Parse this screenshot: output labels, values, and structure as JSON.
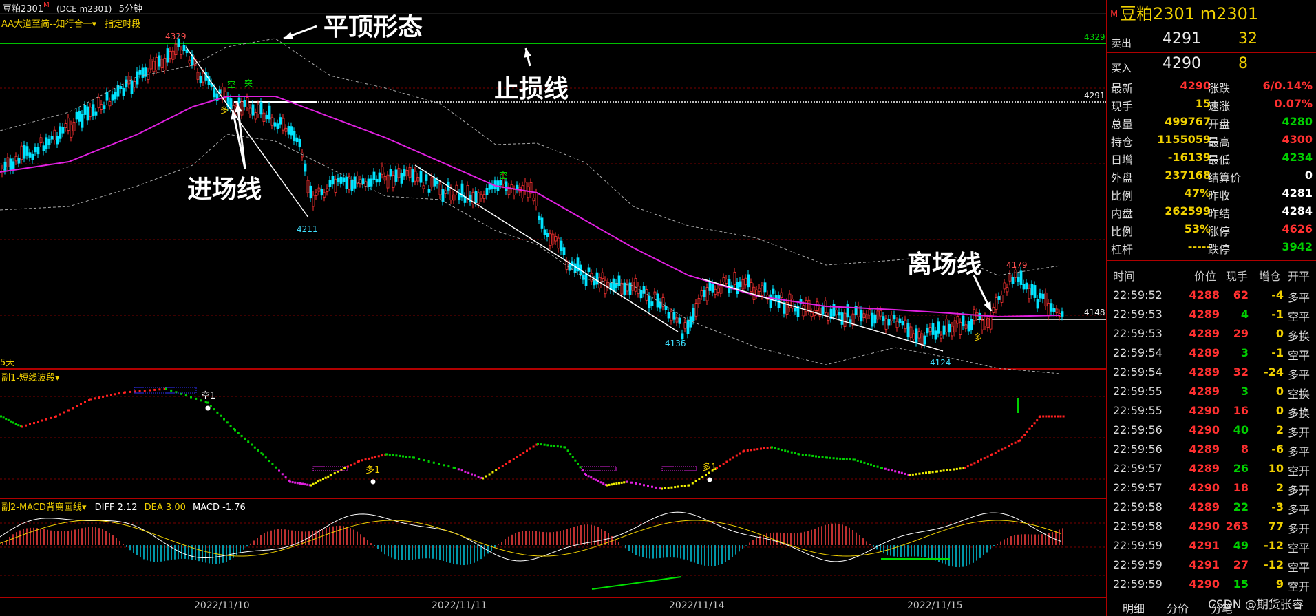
{
  "window": {
    "symbol": "豆粕2301",
    "mark": "M",
    "contract": "(DCE m2301)",
    "period": "5分钟"
  },
  "main_indicator": {
    "name": "AA大道至简--知行合一",
    "dropdown": "▾",
    "extra": "指定时段"
  },
  "annotations": {
    "flat_top": "平顶形态",
    "stop_loss": "止损线",
    "entry": "进场线",
    "exit": "离场线"
  },
  "price_marks": {
    "high": "4329",
    "low1": "4211",
    "low2": "4136",
    "low3": "4124",
    "peak2": "4179",
    "right_4329": "4329",
    "right_4291": "4291",
    "right_4148": "4148",
    "left_days": "5天"
  },
  "signals": {
    "kong": "空",
    "tu": "突",
    "duo": "多",
    "kong1": "空1",
    "duo1": "多1"
  },
  "sub1": {
    "name": "副1-短线波段",
    "dropdown": "▾"
  },
  "sub2": {
    "name": "副2-MACD背离画线",
    "dropdown": "▾",
    "diff_label": "DIFF",
    "diff": "2.12",
    "dea_label": "DEA",
    "dea": "3.00",
    "macd_label": "MACD",
    "macd": "-1.76"
  },
  "dates": [
    "2022/11/10",
    "2022/11/11",
    "2022/11/14",
    "2022/11/15"
  ],
  "colors": {
    "up": "#ff3232",
    "down": "#00e4ff",
    "ma": "#e020e0",
    "green": "#00d000",
    "yellow": "#f0d000",
    "border": "#b00000"
  },
  "right_panel": {
    "mark": "M",
    "title": "豆粕2301  m2301",
    "ask": {
      "label": "卖出",
      "price": "4291",
      "vol": "32"
    },
    "bid": {
      "label": "买入",
      "price": "4290",
      "vol": "8"
    },
    "quotes": [
      {
        "k": "最新",
        "v": "4290",
        "vc": "#ff3030",
        "k2": "涨跌",
        "v2": "6/0.14%",
        "v2c": "#ff3030"
      },
      {
        "k": "现手",
        "v": "15",
        "vc": "#f0d000",
        "k2": "速涨",
        "v2": "0.07%",
        "v2c": "#ff3030"
      },
      {
        "k": "总量",
        "v": "499767",
        "vc": "#f0d000",
        "k2": "开盘",
        "v2": "4280",
        "v2c": "#00d000"
      },
      {
        "k": "持仓",
        "v": "1155059",
        "vc": "#f0d000",
        "k2": "最高",
        "v2": "4300",
        "v2c": "#ff3030"
      },
      {
        "k": "日增",
        "v": "-16139",
        "vc": "#f0d000",
        "k2": "最低",
        "v2": "4234",
        "v2c": "#00d000"
      },
      {
        "k": "外盘",
        "v": "237168",
        "vc": "#f0d000",
        "k2": "结算价",
        "v2": "0",
        "v2c": "#ffffff"
      },
      {
        "k": "比例",
        "v": "47%",
        "vc": "#f0d000",
        "k2": "昨收",
        "v2": "4281",
        "v2c": "#ffffff"
      },
      {
        "k": "内盘",
        "v": "262599",
        "vc": "#f0d000",
        "k2": "昨结",
        "v2": "4284",
        "v2c": "#ffffff"
      },
      {
        "k": "比例",
        "v": "53%",
        "vc": "#f0d000",
        "k2": "涨停",
        "v2": "4626",
        "v2c": "#ff3030"
      },
      {
        "k": "杠杆",
        "v": "-----",
        "vc": "#f0d000",
        "k2": "跌停",
        "v2": "3942",
        "v2c": "#00d000"
      }
    ],
    "tick_headers": {
      "time": "时间",
      "price": "价位",
      "hand": "现手",
      "inc": "增仓",
      "dir": "开平"
    },
    "ticks": [
      {
        "t": "22:59:52",
        "p": "4288",
        "h": "62",
        "z": "-4",
        "d": "多平",
        "zc": "#f0d000"
      },
      {
        "t": "22:59:53",
        "p": "4289",
        "h": "4",
        "z": "-1",
        "d": "空平",
        "zc": "#f0d000"
      },
      {
        "t": "22:59:53",
        "p": "4289",
        "h": "29",
        "z": "0",
        "d": "多换",
        "zc": "#f0d000"
      },
      {
        "t": "22:59:54",
        "p": "4289",
        "h": "3",
        "z": "-1",
        "d": "空平",
        "zc": "#f0d000"
      },
      {
        "t": "22:59:54",
        "p": "4289",
        "h": "32",
        "z": "-24",
        "d": "多平",
        "zc": "#f0d000"
      },
      {
        "t": "22:59:55",
        "p": "4289",
        "h": "3",
        "z": "0",
        "d": "空换",
        "zc": "#f0d000"
      },
      {
        "t": "22:59:55",
        "p": "4290",
        "h": "16",
        "z": "0",
        "d": "多换",
        "zc": "#f0d000"
      },
      {
        "t": "22:59:56",
        "p": "4290",
        "h": "40",
        "z": "2",
        "d": "多开",
        "zc": "#f0d000"
      },
      {
        "t": "22:59:56",
        "p": "4289",
        "h": "8",
        "z": "-6",
        "d": "多平",
        "zc": "#f0d000"
      },
      {
        "t": "22:59:57",
        "p": "4289",
        "h": "26",
        "z": "10",
        "d": "空开",
        "zc": "#f0d000"
      },
      {
        "t": "22:59:57",
        "p": "4290",
        "h": "18",
        "z": "2",
        "d": "多开",
        "zc": "#f0d000"
      },
      {
        "t": "22:59:58",
        "p": "4289",
        "h": "22",
        "z": "-3",
        "d": "多平",
        "zc": "#f0d000"
      },
      {
        "t": "22:59:58",
        "p": "4290",
        "h": "263",
        "z": "77",
        "d": "多开",
        "zc": "#f0d000"
      },
      {
        "t": "22:59:59",
        "p": "4291",
        "h": "49",
        "z": "-12",
        "d": "空平",
        "zc": "#f0d000"
      },
      {
        "t": "22:59:59",
        "p": "4291",
        "h": "27",
        "z": "-12",
        "d": "空平",
        "zc": "#f0d000"
      },
      {
        "t": "22:59:59",
        "p": "4290",
        "h": "15",
        "z": "9",
        "d": "空开",
        "zc": "#f0d000"
      }
    ],
    "tabs": [
      "明细",
      "分价",
      "分笔"
    ]
  },
  "watermark": "CSDN @期货张睿"
}
